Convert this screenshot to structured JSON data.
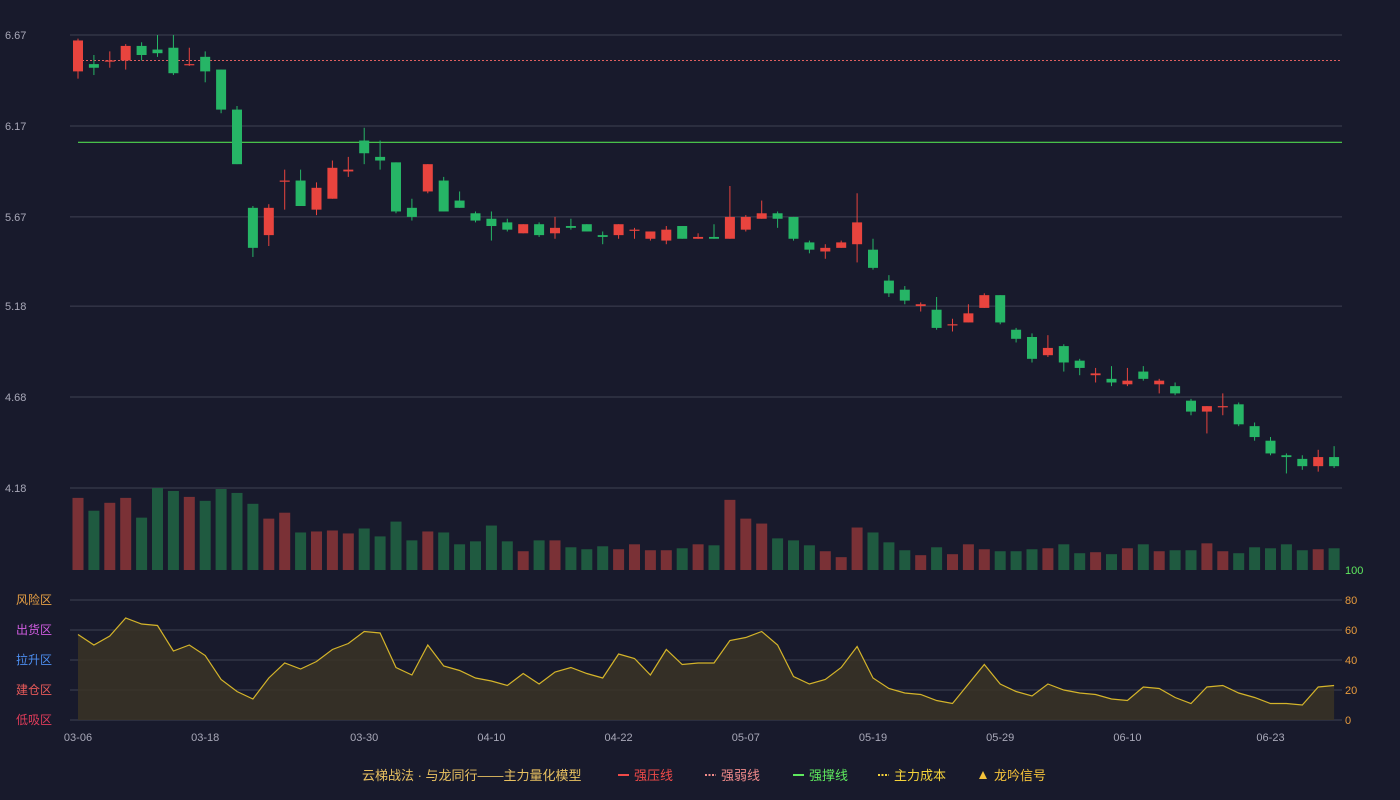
{
  "chart_data": {
    "type": "candlestick",
    "x_tick_labels": [
      "03-06",
      "03-18",
      "03-30",
      "04-10",
      "04-22",
      "05-07",
      "05-19",
      "05-29",
      "06-10",
      "06-23"
    ],
    "price_axis_ticks": [
      "6.67",
      "6.17",
      "5.67",
      "5.18",
      "4.68",
      "4.18"
    ],
    "price_range": [
      4.18,
      6.67
    ],
    "dates": [
      "03-06",
      "03-07",
      "03-10",
      "03-11",
      "03-12",
      "03-13",
      "03-14",
      "03-17",
      "03-18",
      "03-19",
      "03-20",
      "03-21",
      "03-24",
      "03-25",
      "03-26",
      "03-27",
      "03-28",
      "03-29",
      "03-30",
      "03-31",
      "04-01",
      "04-02",
      "04-03",
      "04-07",
      "04-08",
      "04-09",
      "04-10",
      "04-11",
      "04-14",
      "04-15",
      "04-16",
      "04-17",
      "04-18",
      "04-21",
      "04-22",
      "04-23",
      "04-24",
      "04-25",
      "04-28",
      "04-29",
      "04-30",
      "05-06",
      "05-07",
      "05-08",
      "05-09",
      "05-12",
      "05-13",
      "05-14",
      "05-15",
      "05-16",
      "05-19",
      "05-20",
      "05-21",
      "05-22",
      "05-23",
      "05-26",
      "05-27",
      "05-28",
      "05-29",
      "05-30",
      "06-02",
      "06-03",
      "06-04",
      "06-05",
      "06-06",
      "06-09",
      "06-10",
      "06-11",
      "06-12",
      "06-13",
      "06-16",
      "06-17",
      "06-18",
      "06-19",
      "06-20",
      "06-23",
      "06-24",
      "06-25",
      "06-26",
      "06-27",
      "06-30"
    ],
    "ohlc": [
      [
        6.47,
        6.64,
        6.43,
        6.65
      ],
      [
        6.51,
        6.49,
        6.45,
        6.56
      ],
      [
        6.53,
        6.53,
        6.49,
        6.58
      ],
      [
        6.53,
        6.61,
        6.48,
        6.62
      ],
      [
        6.61,
        6.56,
        6.53,
        6.63
      ],
      [
        6.59,
        6.57,
        6.55,
        6.67
      ],
      [
        6.6,
        6.46,
        6.45,
        6.67
      ],
      [
        6.51,
        6.51,
        6.5,
        6.6
      ],
      [
        6.55,
        6.47,
        6.41,
        6.58
      ],
      [
        6.48,
        6.26,
        6.24,
        6.48
      ],
      [
        6.26,
        5.96,
        5.96,
        6.28
      ],
      [
        5.72,
        5.5,
        5.45,
        5.73
      ],
      [
        5.57,
        5.72,
        5.51,
        5.74
      ],
      [
        5.87,
        5.87,
        5.71,
        5.93
      ],
      [
        5.87,
        5.73,
        5.73,
        5.93
      ],
      [
        5.71,
        5.83,
        5.68,
        5.86
      ],
      [
        5.77,
        5.94,
        5.77,
        5.98
      ],
      [
        5.92,
        5.93,
        5.89,
        6.0
      ],
      [
        6.09,
        6.02,
        5.96,
        6.16
      ],
      [
        6.0,
        5.98,
        5.93,
        6.09
      ],
      [
        5.97,
        5.7,
        5.69,
        5.97
      ],
      [
        5.72,
        5.67,
        5.65,
        5.77
      ],
      [
        5.81,
        5.96,
        5.8,
        5.96
      ],
      [
        5.87,
        5.7,
        5.7,
        5.89
      ],
      [
        5.76,
        5.72,
        5.72,
        5.81
      ],
      [
        5.69,
        5.65,
        5.64,
        5.7
      ],
      [
        5.66,
        5.62,
        5.54,
        5.7
      ],
      [
        5.64,
        5.6,
        5.59,
        5.66
      ],
      [
        5.58,
        5.63,
        5.58,
        5.63
      ],
      [
        5.63,
        5.57,
        5.56,
        5.64
      ],
      [
        5.58,
        5.61,
        5.55,
        5.67
      ],
      [
        5.62,
        5.61,
        5.6,
        5.66
      ],
      [
        5.63,
        5.59,
        5.59,
        5.63
      ],
      [
        5.57,
        5.56,
        5.52,
        5.59
      ],
      [
        5.57,
        5.63,
        5.55,
        5.63
      ],
      [
        5.6,
        5.6,
        5.55,
        5.61
      ],
      [
        5.55,
        5.59,
        5.54,
        5.59
      ],
      [
        5.54,
        5.6,
        5.52,
        5.62
      ],
      [
        5.62,
        5.55,
        5.55,
        5.62
      ],
      [
        5.55,
        5.56,
        5.55,
        5.58
      ],
      [
        5.56,
        5.55,
        5.55,
        5.63
      ],
      [
        5.55,
        5.67,
        5.55,
        5.84
      ],
      [
        5.6,
        5.67,
        5.59,
        5.68
      ],
      [
        5.66,
        5.69,
        5.66,
        5.76
      ],
      [
        5.69,
        5.66,
        5.61,
        5.7
      ],
      [
        5.67,
        5.55,
        5.54,
        5.67
      ],
      [
        5.53,
        5.49,
        5.47,
        5.54
      ],
      [
        5.48,
        5.5,
        5.44,
        5.52
      ],
      [
        5.5,
        5.53,
        5.5,
        5.54
      ],
      [
        5.52,
        5.64,
        5.42,
        5.8
      ],
      [
        5.49,
        5.39,
        5.38,
        5.55
      ],
      [
        5.32,
        5.25,
        5.23,
        5.35
      ],
      [
        5.27,
        5.21,
        5.19,
        5.29
      ],
      [
        5.18,
        5.19,
        5.15,
        5.2
      ],
      [
        5.16,
        5.06,
        5.05,
        5.23
      ],
      [
        5.08,
        5.08,
        5.04,
        5.11
      ],
      [
        5.09,
        5.14,
        5.09,
        5.19
      ],
      [
        5.17,
        5.24,
        5.17,
        5.25
      ],
      [
        5.24,
        5.09,
        5.08,
        5.24
      ],
      [
        5.05,
        5.0,
        4.98,
        5.06
      ],
      [
        5.01,
        4.89,
        4.87,
        5.03
      ],
      [
        4.91,
        4.95,
        4.9,
        5.02
      ],
      [
        4.96,
        4.87,
        4.82,
        4.97
      ],
      [
        4.88,
        4.84,
        4.8,
        4.89
      ],
      [
        4.8,
        4.81,
        4.76,
        4.84
      ],
      [
        4.78,
        4.76,
        4.74,
        4.85
      ],
      [
        4.75,
        4.77,
        4.74,
        4.84
      ],
      [
        4.82,
        4.78,
        4.77,
        4.85
      ],
      [
        4.75,
        4.77,
        4.7,
        4.78
      ],
      [
        4.74,
        4.7,
        4.69,
        4.76
      ],
      [
        4.66,
        4.6,
        4.58,
        4.67
      ],
      [
        4.6,
        4.63,
        4.48,
        4.63
      ],
      [
        4.63,
        4.63,
        4.58,
        4.7
      ],
      [
        4.64,
        4.53,
        4.52,
        4.65
      ],
      [
        4.52,
        4.46,
        4.44,
        4.54
      ],
      [
        4.44,
        4.37,
        4.36,
        4.46
      ],
      [
        4.36,
        4.35,
        4.26,
        4.37
      ],
      [
        4.34,
        4.3,
        4.28,
        4.36
      ],
      [
        4.3,
        4.35,
        4.27,
        4.39
      ],
      [
        4.35,
        4.3,
        4.29,
        4.41
      ]
    ],
    "volume": [
      73,
      60,
      68,
      73,
      53,
      83,
      80,
      74,
      70,
      82,
      78,
      67,
      52,
      58,
      38,
      39,
      40,
      37,
      42,
      34,
      49,
      30,
      39,
      38,
      26,
      29,
      45,
      29,
      19,
      30,
      30,
      23,
      21,
      24,
      21,
      26,
      20,
      20,
      22,
      26,
      25,
      71,
      52,
      47,
      32,
      30,
      25,
      19,
      13,
      43,
      38,
      28,
      20,
      15,
      23,
      16,
      26,
      21,
      19,
      19,
      21,
      22,
      26,
      17,
      18,
      16,
      22,
      26,
      19,
      20,
      20,
      27,
      19,
      17,
      23,
      22,
      26,
      20,
      21,
      22
    ],
    "oscillator": {
      "y_ticks": [
        "100",
        "80",
        "60",
        "40",
        "20",
        "0"
      ],
      "ylim": [
        0,
        100
      ],
      "zones": [
        "风险区",
        "出货区",
        "拉升区",
        "建仓区",
        "低吸区"
      ],
      "values": [
        57,
        50,
        56,
        68,
        64,
        63,
        46,
        50,
        43,
        27,
        19,
        14,
        28,
        38,
        34,
        39,
        47,
        51,
        59,
        58,
        35,
        30,
        50,
        36,
        33,
        28,
        26,
        23,
        31,
        24,
        32,
        35,
        31,
        28,
        44,
        41,
        30,
        47,
        37,
        38,
        38,
        53,
        55,
        59,
        50,
        29,
        24,
        27,
        35,
        49,
        28,
        21,
        18,
        17,
        13,
        11,
        24,
        37,
        24,
        19,
        16,
        24,
        20,
        18,
        17,
        14,
        13,
        22,
        21,
        15,
        11,
        22,
        23,
        18,
        15,
        11,
        11,
        10,
        22,
        23
      ]
    },
    "reference_lines": [
      {
        "label": "强弱线",
        "value": 6.53,
        "style": "dashed"
      },
      {
        "label": "强撑线",
        "value": 6.08,
        "style": "solid"
      }
    ],
    "legend": {
      "model_name": "云梯战法 · 与龙同行——主力量化模型",
      "items": [
        {
          "label": "强压线",
          "icon": "solid-line",
          "color": "#f04a48"
        },
        {
          "label": "强弱线",
          "icon": "dashed-line",
          "color": "#f08a8a"
        },
        {
          "label": "强撑线",
          "icon": "solid-line",
          "color": "#5ee85e"
        },
        {
          "label": "主力成本",
          "icon": "dashed-line",
          "color": "#f4d23a"
        },
        {
          "label": "龙吟信号",
          "icon": "triangle-up",
          "color": "#f4c23a"
        }
      ]
    },
    "colors": {
      "background": "#181a2c",
      "up": "#e8443e",
      "down": "#26b566",
      "volume_up": "#7a3136",
      "volume_down": "#1f5a40",
      "oscillator_line": "#d4b42a",
      "oscillator_fill": "#3a3426",
      "grid": "#3e4152",
      "axis_text": "#a8a8b8",
      "weak_line": "#e06060",
      "support_line": "#4fd94f",
      "osc_axis_100": "#5ee85e",
      "osc_axis_text": "#e89a3c",
      "zone_colors": [
        "#e8a044",
        "#d05ce0",
        "#4c8ef0",
        "#e85a5a",
        "#e03c5a"
      ]
    }
  }
}
